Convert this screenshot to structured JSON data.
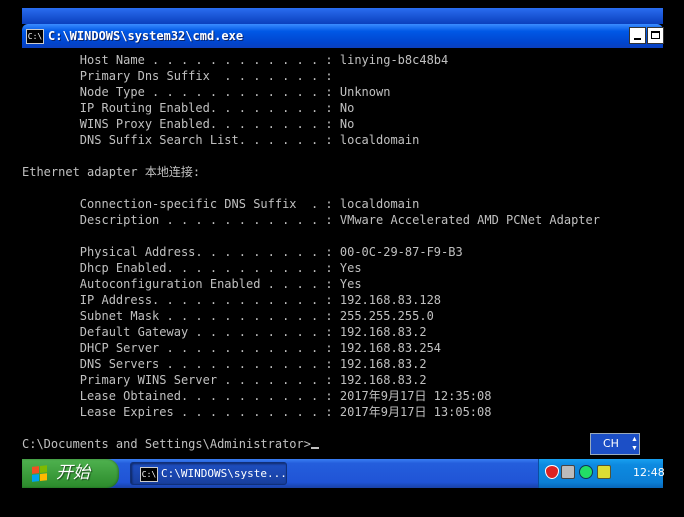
{
  "window": {
    "title": "C:\\WINDOWS\\system32\\cmd.exe",
    "icon_label": "C:\\"
  },
  "console": {
    "lines": [
      "        Host Name . . . . . . . . . . . . : linying-b8c48b4",
      "        Primary Dns Suffix  . . . . . . . :",
      "        Node Type . . . . . . . . . . . . : Unknown",
      "        IP Routing Enabled. . . . . . . . : No",
      "        WINS Proxy Enabled. . . . . . . . : No",
      "        DNS Suffix Search List. . . . . . : localdomain",
      "",
      "Ethernet adapter 本地连接:",
      "",
      "        Connection-specific DNS Suffix  . : localdomain",
      "        Description . . . . . . . . . . . : VMware Accelerated AMD PCNet Adapter",
      "",
      "        Physical Address. . . . . . . . . : 00-0C-29-87-F9-B3",
      "        Dhcp Enabled. . . . . . . . . . . : Yes",
      "        Autoconfiguration Enabled . . . . : Yes",
      "        IP Address. . . . . . . . . . . . : 192.168.83.128",
      "        Subnet Mask . . . . . . . . . . . : 255.255.255.0",
      "        Default Gateway . . . . . . . . . : 192.168.83.2",
      "        DHCP Server . . . . . . . . . . . : 192.168.83.254",
      "        DNS Servers . . . . . . . . . . . : 192.168.83.2",
      "        Primary WINS Server . . . . . . . : 192.168.83.2",
      "        Lease Obtained. . . . . . . . . . : 2017年9月17日 12:35:08",
      "        Lease Expires . . . . . . . . . . : 2017年9月17日 13:05:08",
      "",
      "C:\\Documents and Settings\\Administrator>"
    ]
  },
  "ime": {
    "label": "CH"
  },
  "taskbar": {
    "start_label": "开始",
    "task_label": "C:\\WINDOWS\\syste...",
    "clock": "12:48"
  },
  "colors": {
    "console_bg": "#000000",
    "console_text": "#c0c0c0",
    "titlebar_blue": "#0058e6",
    "start_green": "#3a9a3a",
    "tray_blue": "#0b7fd6"
  }
}
